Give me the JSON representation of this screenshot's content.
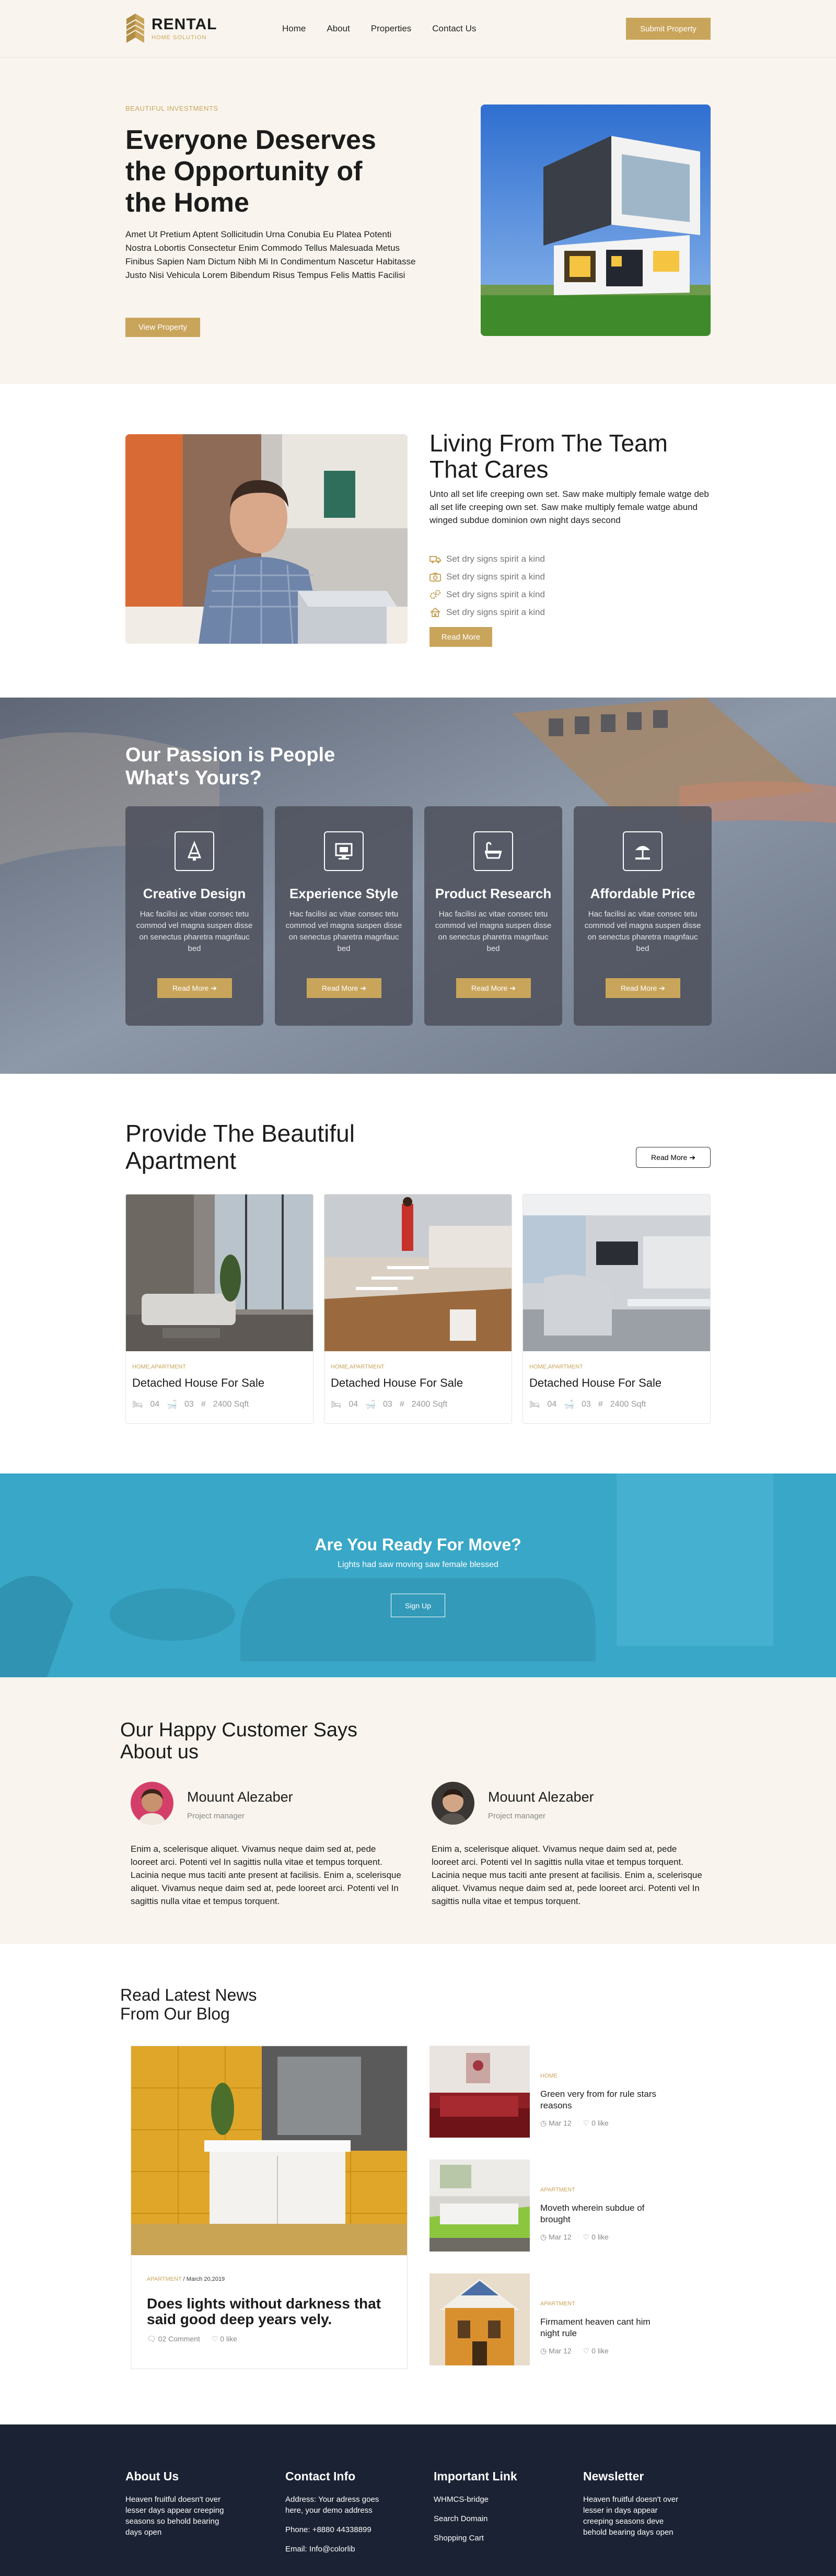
{
  "header": {
    "logo_title": "RENTAL",
    "logo_subtitle": "HOME SOLUTION",
    "nav": [
      "Home",
      "About",
      "Properties",
      "Contact Us"
    ],
    "cta": "Submit Property"
  },
  "hero": {
    "kicker": "BEAUTIFUL INVESTMENTS",
    "title": "Everyone Deserves the Opportunity of the Home",
    "text": "Amet Ut Pretium Aptent Sollicitudin Urna Conubia Eu Platea Potenti Nostra Lobortis Consectetur Enim Commodo Tellus Malesuada Metus Finibus Sapien Nam Dictum Nibh Mi In Condimentum Nascetur Habitasse Justo Nisi Vehicula Lorem Bibendum Risus Tempus Felis Mattis Facilisi",
    "button": "View Property"
  },
  "team": {
    "title": "Living From The Team That Cares",
    "text": "Unto all set life creeping own set. Saw make multiply female watge deb all set life creeping own set. Saw make multiply female watge abund winged subdue dominion own night days second",
    "items": [
      "Set dry signs spirit a kind",
      "Set dry signs spirit a kind",
      "Set dry signs spirit a kind",
      "Set dry signs spirit a kind"
    ],
    "icons": [
      "truck-icon",
      "camera-icon",
      "gears-icon",
      "home-icon"
    ],
    "button": "Read More"
  },
  "passion": {
    "title": "Our Passion is People What's Yours?",
    "cards": [
      {
        "title": "Creative Design",
        "text": "Hac facilisi ac vitae consec tetu commod vel magna suspen disse on senectus pharetra magnfauc bed",
        "button": "Read More"
      },
      {
        "title": "Experience Style",
        "text": "Hac facilisi ac vitae consec tetu commod vel magna suspen disse on senectus pharetra magnfauc bed",
        "button": "Read More"
      },
      {
        "title": "Product Research",
        "text": "Hac facilisi ac vitae consec tetu commod vel magna suspen disse on senectus pharetra magnfauc bed",
        "button": "Read More"
      },
      {
        "title": "Affordable Price",
        "text": "Hac facilisi ac vitae consec tetu commod vel magna suspen disse on senectus pharetra magnfauc bed",
        "button": "Read More"
      }
    ]
  },
  "apartment": {
    "title": "Provide The Beautiful Apartment",
    "button": "Read More",
    "cards": [
      {
        "tag": "HOME,APARTMENT",
        "title": "Detached House For Sale",
        "beds": "04",
        "baths": "03",
        "area": "2400 Sqft"
      },
      {
        "tag": "HOME,APARTMENT",
        "title": "Detached House For Sale",
        "beds": "04",
        "baths": "03",
        "area": "2400 Sqft"
      },
      {
        "tag": "HOME,APARTMENT",
        "title": "Detached House For Sale",
        "beds": "04",
        "baths": "03",
        "area": "2400 Sqft"
      }
    ]
  },
  "move": {
    "title": "Are You Ready For Move?",
    "text": "Lights had saw moving saw female blessed",
    "button": "Sign Up"
  },
  "testimonials": {
    "title": "Our Happy Customer Says About us",
    "items": [
      {
        "name": "Mouunt Alezaber",
        "role": "Project manager",
        "text": "Enim a, scelerisque aliquet. Vivamus neque daim sed at, pede looreet arci. Potenti vel In sagittis nulla vitae et tempus torquent. Lacinia neque mus taciti ante present at facilisis. Enim a, scelerisque aliquet. Vivamus neque daim sed at, pede looreet arci. Potenti vel In sagittis nulla vitae et tempus torquent."
      },
      {
        "name": "Mouunt Alezaber",
        "role": "Project manager",
        "text": "Enim a, scelerisque aliquet. Vivamus neque daim sed at, pede looreet arci. Potenti vel In sagittis nulla vitae et tempus torquent. Lacinia neque mus taciti ante present at facilisis. Enim a, scelerisque aliquet. Vivamus neque daim sed at, pede looreet arci. Potenti vel In sagittis nulla vitae et tempus torquent."
      }
    ]
  },
  "blog": {
    "title": "Read Latest News From Our Blog",
    "main": {
      "category": "APARTMENT",
      "date": " / March 20,2019",
      "title": "Does lights without darkness that said good deep years vely.",
      "comments": "02 Comment",
      "likes": "0 like"
    },
    "side": [
      {
        "tag": "HOME",
        "title": "Green very from for rule stars reasons",
        "date": "Mar 12",
        "likes": "0 like"
      },
      {
        "tag": "APARTMENT",
        "title": "Moveth wherein subdue of brought",
        "date": "Mar 12",
        "likes": "0 like"
      },
      {
        "tag": "APARTMENT",
        "title": "Firmament heaven cant him night rule",
        "date": "Mar 12",
        "likes": "0 like"
      }
    ]
  },
  "footer": {
    "about_title": "About Us",
    "about_text": "Heaven fruitful doesn't over lesser days appear creeping seasons so behold bearing days open",
    "contact_title": "Contact Info",
    "contact_address": "Address: Your adress goes here, your demo address",
    "contact_phone": "Phone: +8880 44338899",
    "contact_email": "Email: Info@colorlib",
    "links_title": "Important Link",
    "links": [
      "WHMCS-bridge",
      "Search Domain",
      "Shopping Cart"
    ],
    "newsletter_title": "Newsletter",
    "newsletter_text": "Heaven fruitful doesn't over lesser in days appear creeping seasons deve behold bearing days open"
  },
  "colors": {
    "accent": "#c9a55c",
    "cream": "#f9f5ee",
    "footer": "#1b2233",
    "teal": "#39a7c7"
  }
}
